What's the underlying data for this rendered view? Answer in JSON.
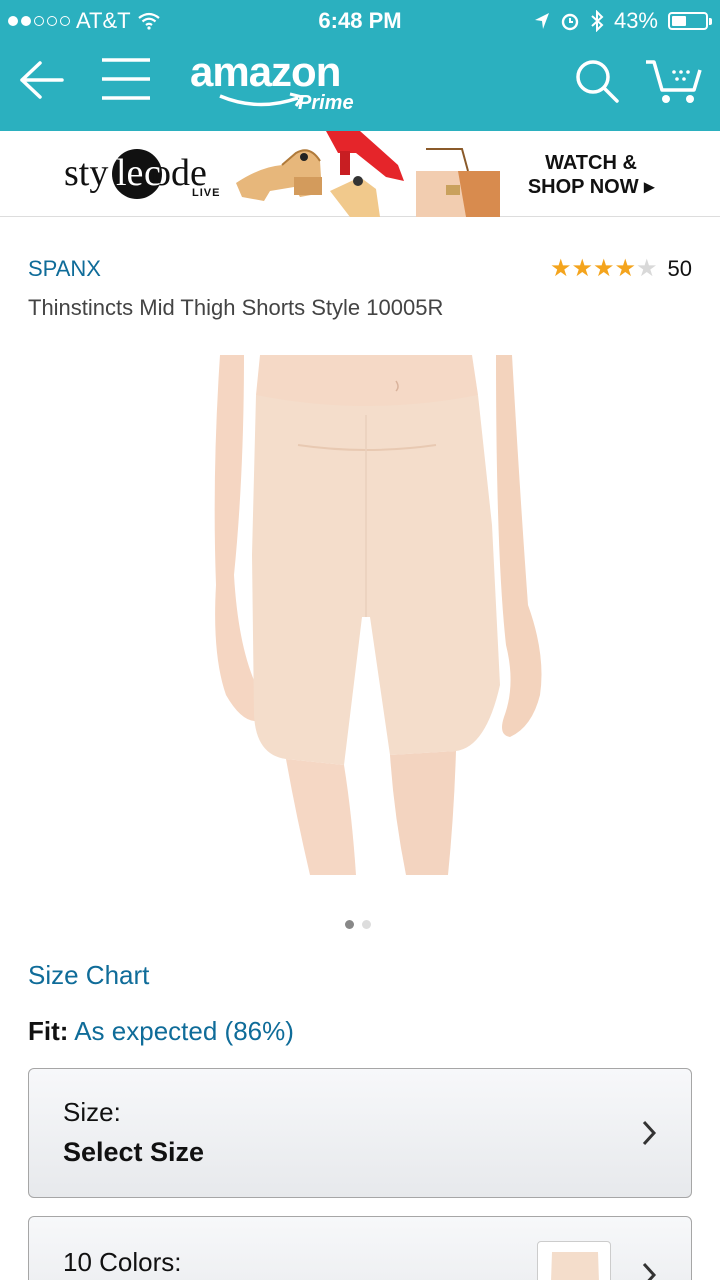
{
  "status_bar": {
    "carrier": "AT&T",
    "time": "6:48 PM",
    "battery": "43%",
    "battery_level": 0.43
  },
  "nav": {
    "logo_word": "amazon",
    "logo_sub": "Prime"
  },
  "banner": {
    "brand_word": "stylecode",
    "live": "LIVE",
    "cta_line1": "WATCH &",
    "cta_line2": "SHOP NOW ▸"
  },
  "product": {
    "brand": "SPANX",
    "title": "Thinstincts Mid Thigh Shorts Style 10005R",
    "rating": 4,
    "rating_max": 5,
    "review_count": "50",
    "image_count": 2,
    "image_index": 1
  },
  "size": {
    "chart_link": "Size Chart",
    "fit_label": "Fit:",
    "fit_value": "As expected (86%)",
    "size_label": "Size:",
    "size_value": "Select Size",
    "colors_label": "10 Colors:"
  },
  "colors": {
    "accent": "#2bb0bf",
    "link": "#0f6c99",
    "star": "#f4a41d"
  }
}
